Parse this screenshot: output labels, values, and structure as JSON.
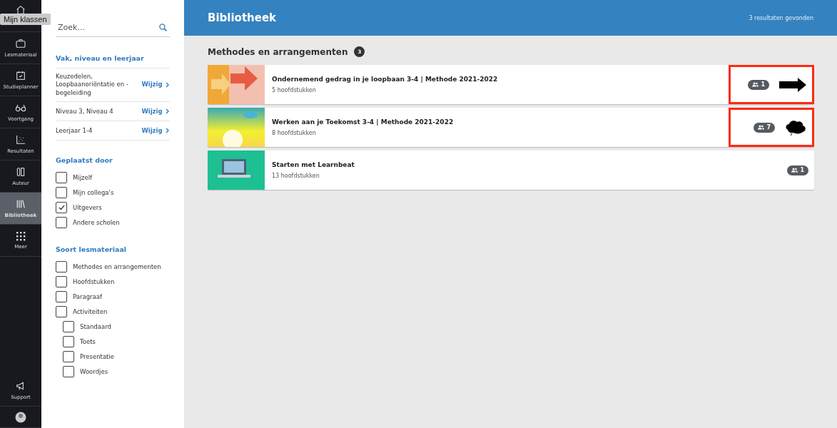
{
  "nav": {
    "tooltip": "Mijn klassen",
    "items": [
      {
        "kind": "home",
        "selected": false
      },
      {
        "kind": "briefcase",
        "label": "Lesmateriaal",
        "selected": false
      },
      {
        "kind": "calendar",
        "label": "Studieplanner",
        "selected": false
      },
      {
        "kind": "glasses",
        "label": "Voortgang",
        "selected": false
      },
      {
        "kind": "chart",
        "label": "Resultaten",
        "selected": false
      },
      {
        "kind": "author",
        "label": "Auteur",
        "selected": false
      },
      {
        "kind": "library",
        "label": "Bibliotheek",
        "selected": true
      },
      {
        "kind": "grid",
        "label": "Meer",
        "selected": false
      }
    ],
    "bottom": [
      {
        "kind": "megaphone",
        "label": "Support"
      },
      {
        "kind": "avatar"
      }
    ]
  },
  "filters": {
    "search": {
      "placeholder": "Zoek..."
    },
    "sections": [
      {
        "kind": "links",
        "title": "Vak, niveau en leerjaar",
        "rows": [
          {
            "text": "Keuzedelen, Loopbaanoriëntatie en - begeleiding",
            "action": "Wijzig"
          },
          {
            "text": "Niveau 3, Niveau 4",
            "action": "Wijzig"
          },
          {
            "text": "Leerjaar 1-4",
            "action": "Wijzig"
          }
        ]
      },
      {
        "kind": "checks",
        "title": "Geplaatst door",
        "options": [
          {
            "label": "Mijzelf",
            "checked": false
          },
          {
            "label": "Mijn collega's",
            "checked": false
          },
          {
            "label": "Uitgevers",
            "checked": true
          },
          {
            "label": "Andere scholen",
            "checked": false
          }
        ]
      },
      {
        "kind": "checks",
        "title": "Soort lesmateriaal",
        "options": [
          {
            "label": "Methodes en arrangementen",
            "checked": false
          },
          {
            "label": "Hoofdstukken",
            "checked": false
          },
          {
            "label": "Paragraaf",
            "checked": false
          },
          {
            "label": "Activiteiten",
            "checked": false,
            "children": [
              {
                "label": "Standaard",
                "checked": false
              },
              {
                "label": "Toets",
                "checked": false
              },
              {
                "label": "Presentatie",
                "checked": false
              },
              {
                "label": "Woordjes",
                "checked": false
              }
            ]
          }
        ]
      }
    ]
  },
  "header": {
    "title": "Bibliotheek",
    "results": "3 resultaten gevonden"
  },
  "section": {
    "title": "Methodes en arrangementen",
    "count": "3"
  },
  "items": [
    {
      "kind": "arrow",
      "title": "Ondernemend gedrag in je loopbaan 3-4 | Methode 2021-2022",
      "subtitle": "5 hoofdstukken",
      "groups": "1",
      "highlighted": true
    },
    {
      "kind": "cloud",
      "title": "Werken aan je Toekomst 3-4 | Methode 2021-2022",
      "subtitle": "8 hoofdstukken",
      "groups": "7",
      "highlighted": true
    },
    {
      "kind": "laptop",
      "title": "Starten met Learnbeat",
      "subtitle": "13 hoofdstukken",
      "groups": "1",
      "highlighted": false
    }
  ]
}
